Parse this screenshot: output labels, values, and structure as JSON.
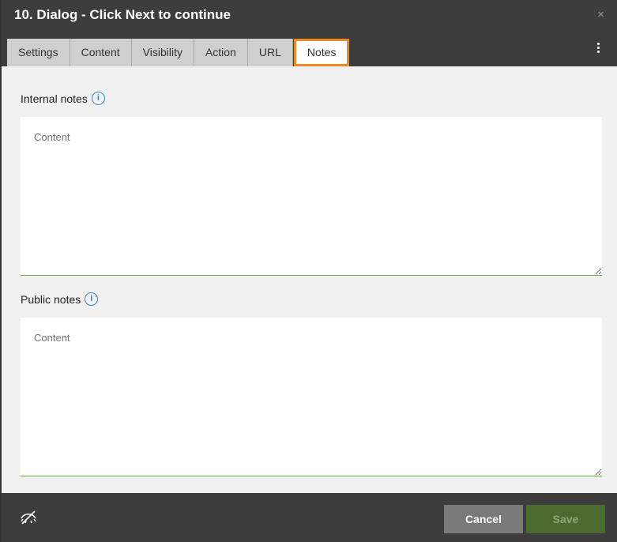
{
  "dialog": {
    "title": "10. Dialog - Click Next to continue",
    "close_glyph": "×"
  },
  "tabs": [
    {
      "label": "Settings",
      "active": false
    },
    {
      "label": "Content",
      "active": false
    },
    {
      "label": "Visibility",
      "active": false
    },
    {
      "label": "Action",
      "active": false
    },
    {
      "label": "URL",
      "active": false
    },
    {
      "label": "Notes",
      "active": true
    }
  ],
  "internal_notes": {
    "label": "Internal notes",
    "info_glyph": "i",
    "placeholder": "Content",
    "value": ""
  },
  "public_notes": {
    "label": "Public notes",
    "info_glyph": "i",
    "placeholder": "Content",
    "value": ""
  },
  "footer": {
    "cancel_label": "Cancel",
    "save_label": "Save"
  },
  "colors": {
    "header_bg": "#3d3d3d",
    "active_tab_outline": "#f08a24",
    "field_underline": "#62b33a",
    "info_icon": "#3a86d6",
    "save_bg": "#4a6a2e"
  },
  "icons": [
    "close-icon",
    "more-vertical-icon",
    "info-icon",
    "eye-off-icon"
  ]
}
